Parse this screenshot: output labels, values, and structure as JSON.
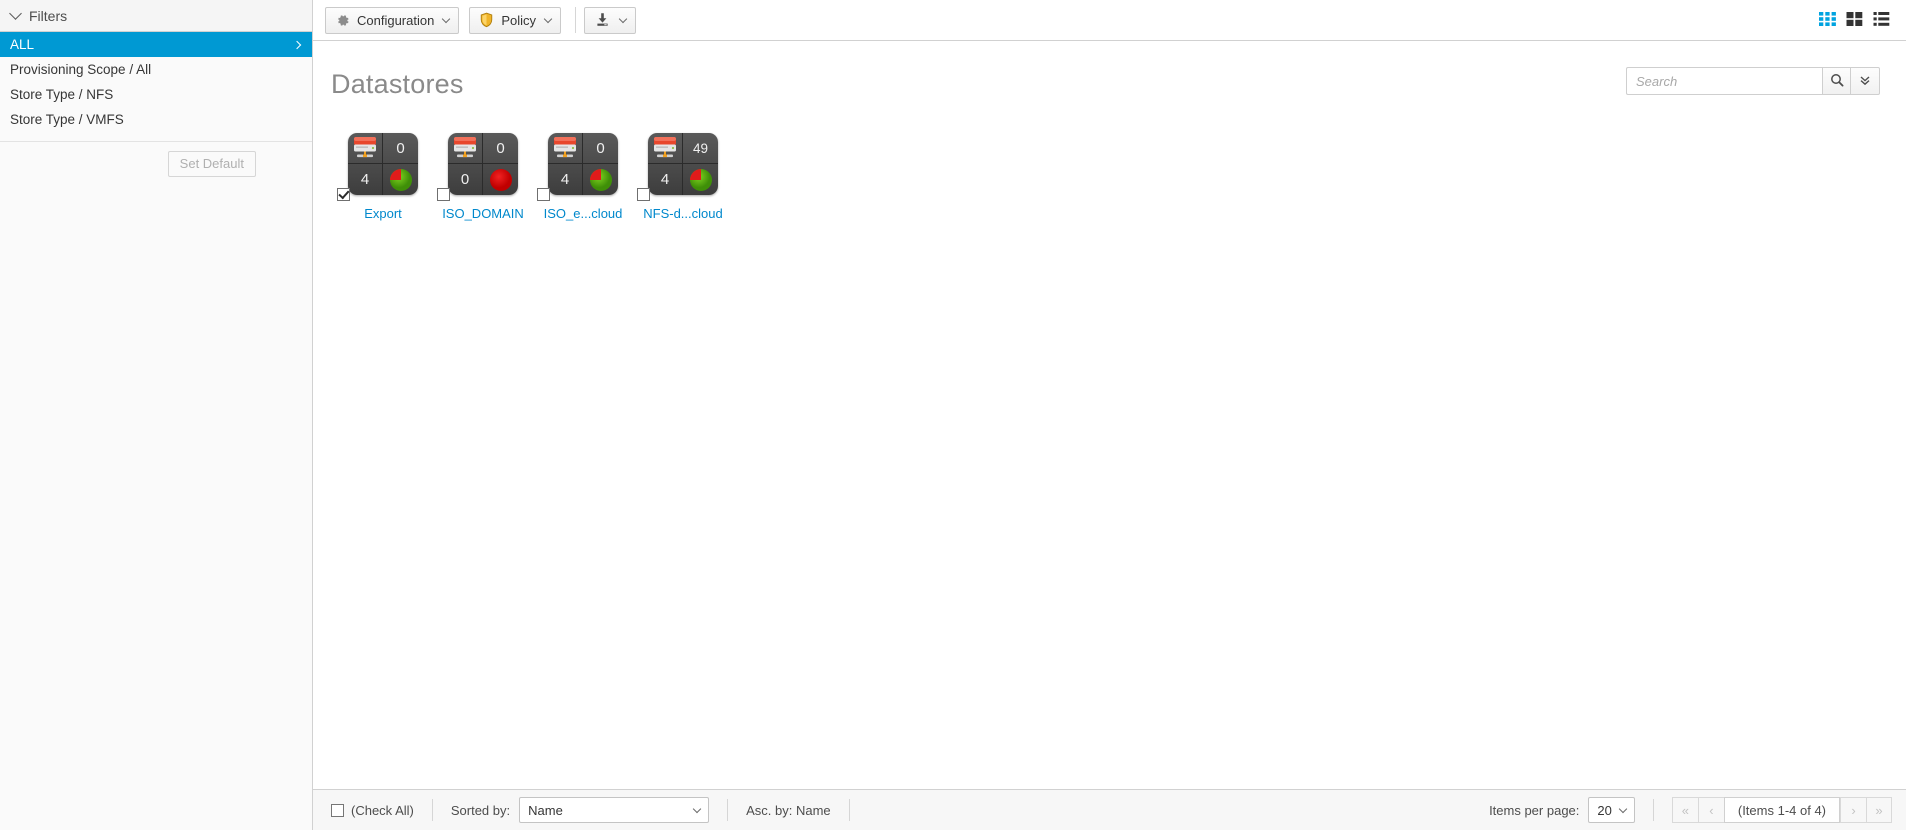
{
  "sidebar": {
    "header": "Filters",
    "collapse_icon": "chevron-down-icon",
    "items": [
      {
        "label": "ALL",
        "active": true
      },
      {
        "label": "Provisioning Scope / All",
        "active": false
      },
      {
        "label": "Store Type / NFS",
        "active": false
      },
      {
        "label": "Store Type / VMFS",
        "active": false
      }
    ],
    "set_default_label": "Set Default",
    "active_color": "#0099d3"
  },
  "toolbar": {
    "configuration_label": "Configuration",
    "configuration_icon": "gear-icon",
    "policy_label": "Policy",
    "policy_icon": "shield-icon",
    "download_icon": "download-icon",
    "view_toggles": [
      {
        "name": "grid-view-toggle",
        "icon": "grid-3x3-icon",
        "active": true
      },
      {
        "name": "tile-view-toggle",
        "icon": "grid-2x2-icon",
        "active": false
      },
      {
        "name": "list-view-toggle",
        "icon": "list-icon",
        "active": false
      }
    ],
    "accent_color": "#0099d3"
  },
  "search": {
    "value": "",
    "placeholder": "Search",
    "search_icon": "magnifier-icon",
    "advanced_icon": "double-chevron-down-icon"
  },
  "main": {
    "title": "Datastores"
  },
  "datastores": [
    {
      "name": "Export",
      "icon": "storage-array-icon",
      "top_right_count": "0",
      "bottom_left_count": "4",
      "pie": {
        "icon": "pie-chart-icon",
        "green_pct": 75,
        "red_pct": 25
      },
      "checked": true
    },
    {
      "name": "ISO_DOMAIN",
      "icon": "storage-array-icon",
      "top_right_count": "0",
      "bottom_left_count": "0",
      "pie": {
        "icon": "pie-chart-icon",
        "green_pct": 0,
        "red_pct": 100
      },
      "checked": false
    },
    {
      "name": "ISO_e...cloud",
      "icon": "storage-array-icon",
      "top_right_count": "0",
      "bottom_left_count": "4",
      "pie": {
        "icon": "pie-chart-icon",
        "green_pct": 75,
        "red_pct": 25
      },
      "checked": false
    },
    {
      "name": "NFS-d...cloud",
      "icon": "storage-array-icon",
      "top_right_count": "49",
      "bottom_left_count": "4",
      "pie": {
        "icon": "pie-chart-icon",
        "green_pct": 75,
        "red_pct": 25
      },
      "checked": false
    }
  ],
  "footer": {
    "check_all_label": "(Check All)",
    "check_all_checked": false,
    "sorted_by_label": "Sorted by:",
    "sorted_by_value": "Name",
    "asc_by_label": "Asc. by: Name",
    "items_per_page_label": "Items per page:",
    "items_per_page_value": "20",
    "pager": {
      "first": "«",
      "prev": "‹",
      "info": "(Items 1-4 of 4)",
      "next": "›",
      "last": "»"
    }
  }
}
